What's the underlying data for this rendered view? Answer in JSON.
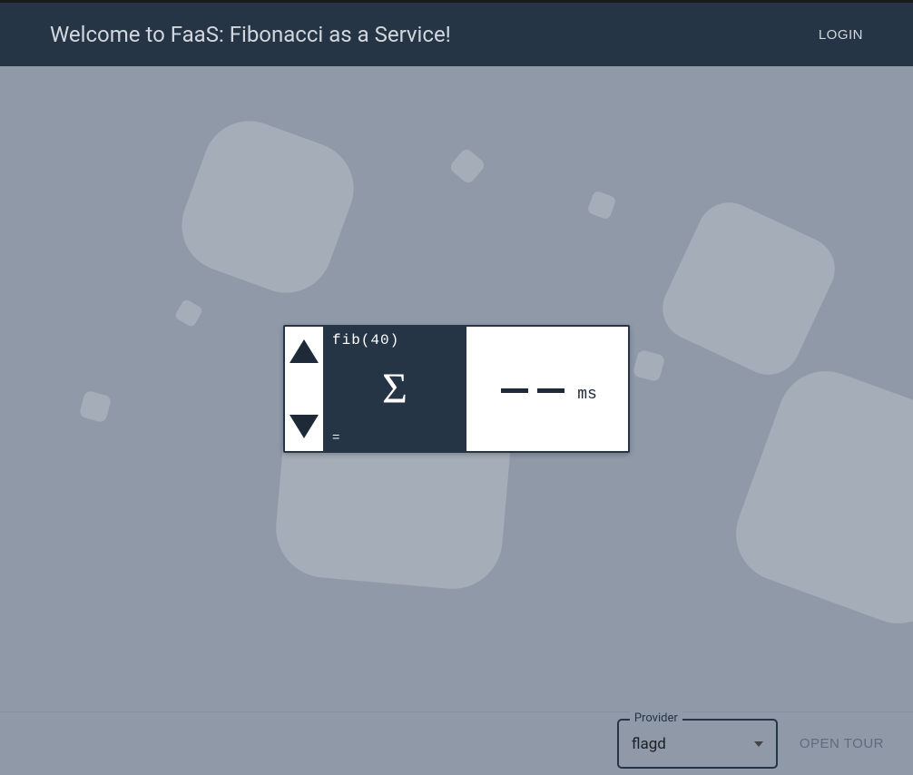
{
  "header": {
    "title": "Welcome to FaaS: Fibonacci as a Service!",
    "login_label": "LOGIN"
  },
  "calculator": {
    "expression": "fib(40)",
    "equals": "=",
    "sigma": "Σ",
    "result_dash1": "—",
    "result_dash2": "—",
    "ms_label": "ms"
  },
  "footer": {
    "provider_legend": "Provider",
    "provider_value": "flagd",
    "open_tour_label": "OPEN TOUR"
  },
  "colors": {
    "header_bg": "#253546",
    "body_bg": "#8f99a8",
    "shape_bg": "#a5adb9"
  }
}
